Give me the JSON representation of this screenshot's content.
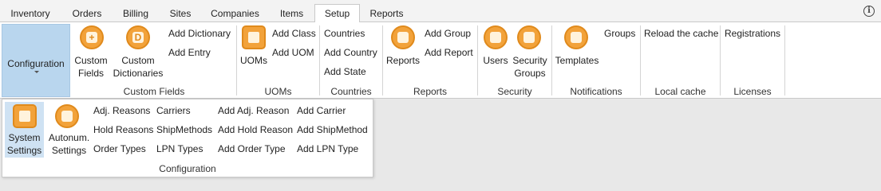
{
  "tabs": [
    "Inventory",
    "Orders",
    "Billing",
    "Sites",
    "Companies",
    "Items",
    "Setup",
    "Reports"
  ],
  "active_tab": "Setup",
  "info_glyph": "i",
  "ribbon": {
    "configuration_label": "Configuration",
    "custom_fields": {
      "custom_fields": "Custom Fields",
      "custom_dictionaries": "Custom Dictionaries",
      "add_dictionary": "Add Dictionary",
      "add_entry": "Add Entry",
      "group": "Custom Fields"
    },
    "uoms": {
      "uoms": "UOMs",
      "add_class": "Add Class",
      "add_uom": "Add UOM",
      "group": "UOMs"
    },
    "countries": {
      "countries": "Countries",
      "add_country": "Add Country",
      "add_state": "Add State",
      "group": "Countries"
    },
    "reports": {
      "reports": "Reports",
      "add_group": "Add Group",
      "add_report": "Add Report",
      "group": "Reports"
    },
    "security": {
      "users": "Users",
      "security_groups": "Security Groups",
      "group": "Security"
    },
    "notifications": {
      "templates": "Templates",
      "groups": "Groups",
      "group": "Notifications"
    },
    "local_cache": {
      "reload": "Reload the cache",
      "group": "Local cache"
    },
    "licenses": {
      "registrations": "Registrations",
      "group": "Licenses"
    }
  },
  "panel": {
    "system_settings": "System Settings",
    "autonum_settings": "Autonum. Settings",
    "adj_reasons": "Adj. Reasons",
    "hold_reasons": "Hold Reasons",
    "order_types": "Order Types",
    "carriers": "Carriers",
    "ship_methods": "ShipMethods",
    "lpn_types": "LPN Types",
    "add_adj_reason": "Add Adj. Reason",
    "add_hold_reason": "Add Hold Reason",
    "add_order_type": "Add Order Type",
    "add_carrier": "Add Carrier",
    "add_ship_method": "Add ShipMethod",
    "add_lpn_type": "Add LPN Type",
    "group": "Configuration"
  },
  "icons": {
    "custom_fields": "custom-fields-icon",
    "custom_dictionaries": "dictionary-icon",
    "uoms": "uoms-icon",
    "reports": "reports-icon",
    "users": "user-icon",
    "security_groups": "security-groups-icon",
    "templates": "bell-icon",
    "system_settings": "system-settings-icon",
    "autonum_settings": "autonum-icon"
  },
  "colors": {
    "accent": "#f2a23a",
    "selected": "#b9d6ee"
  }
}
